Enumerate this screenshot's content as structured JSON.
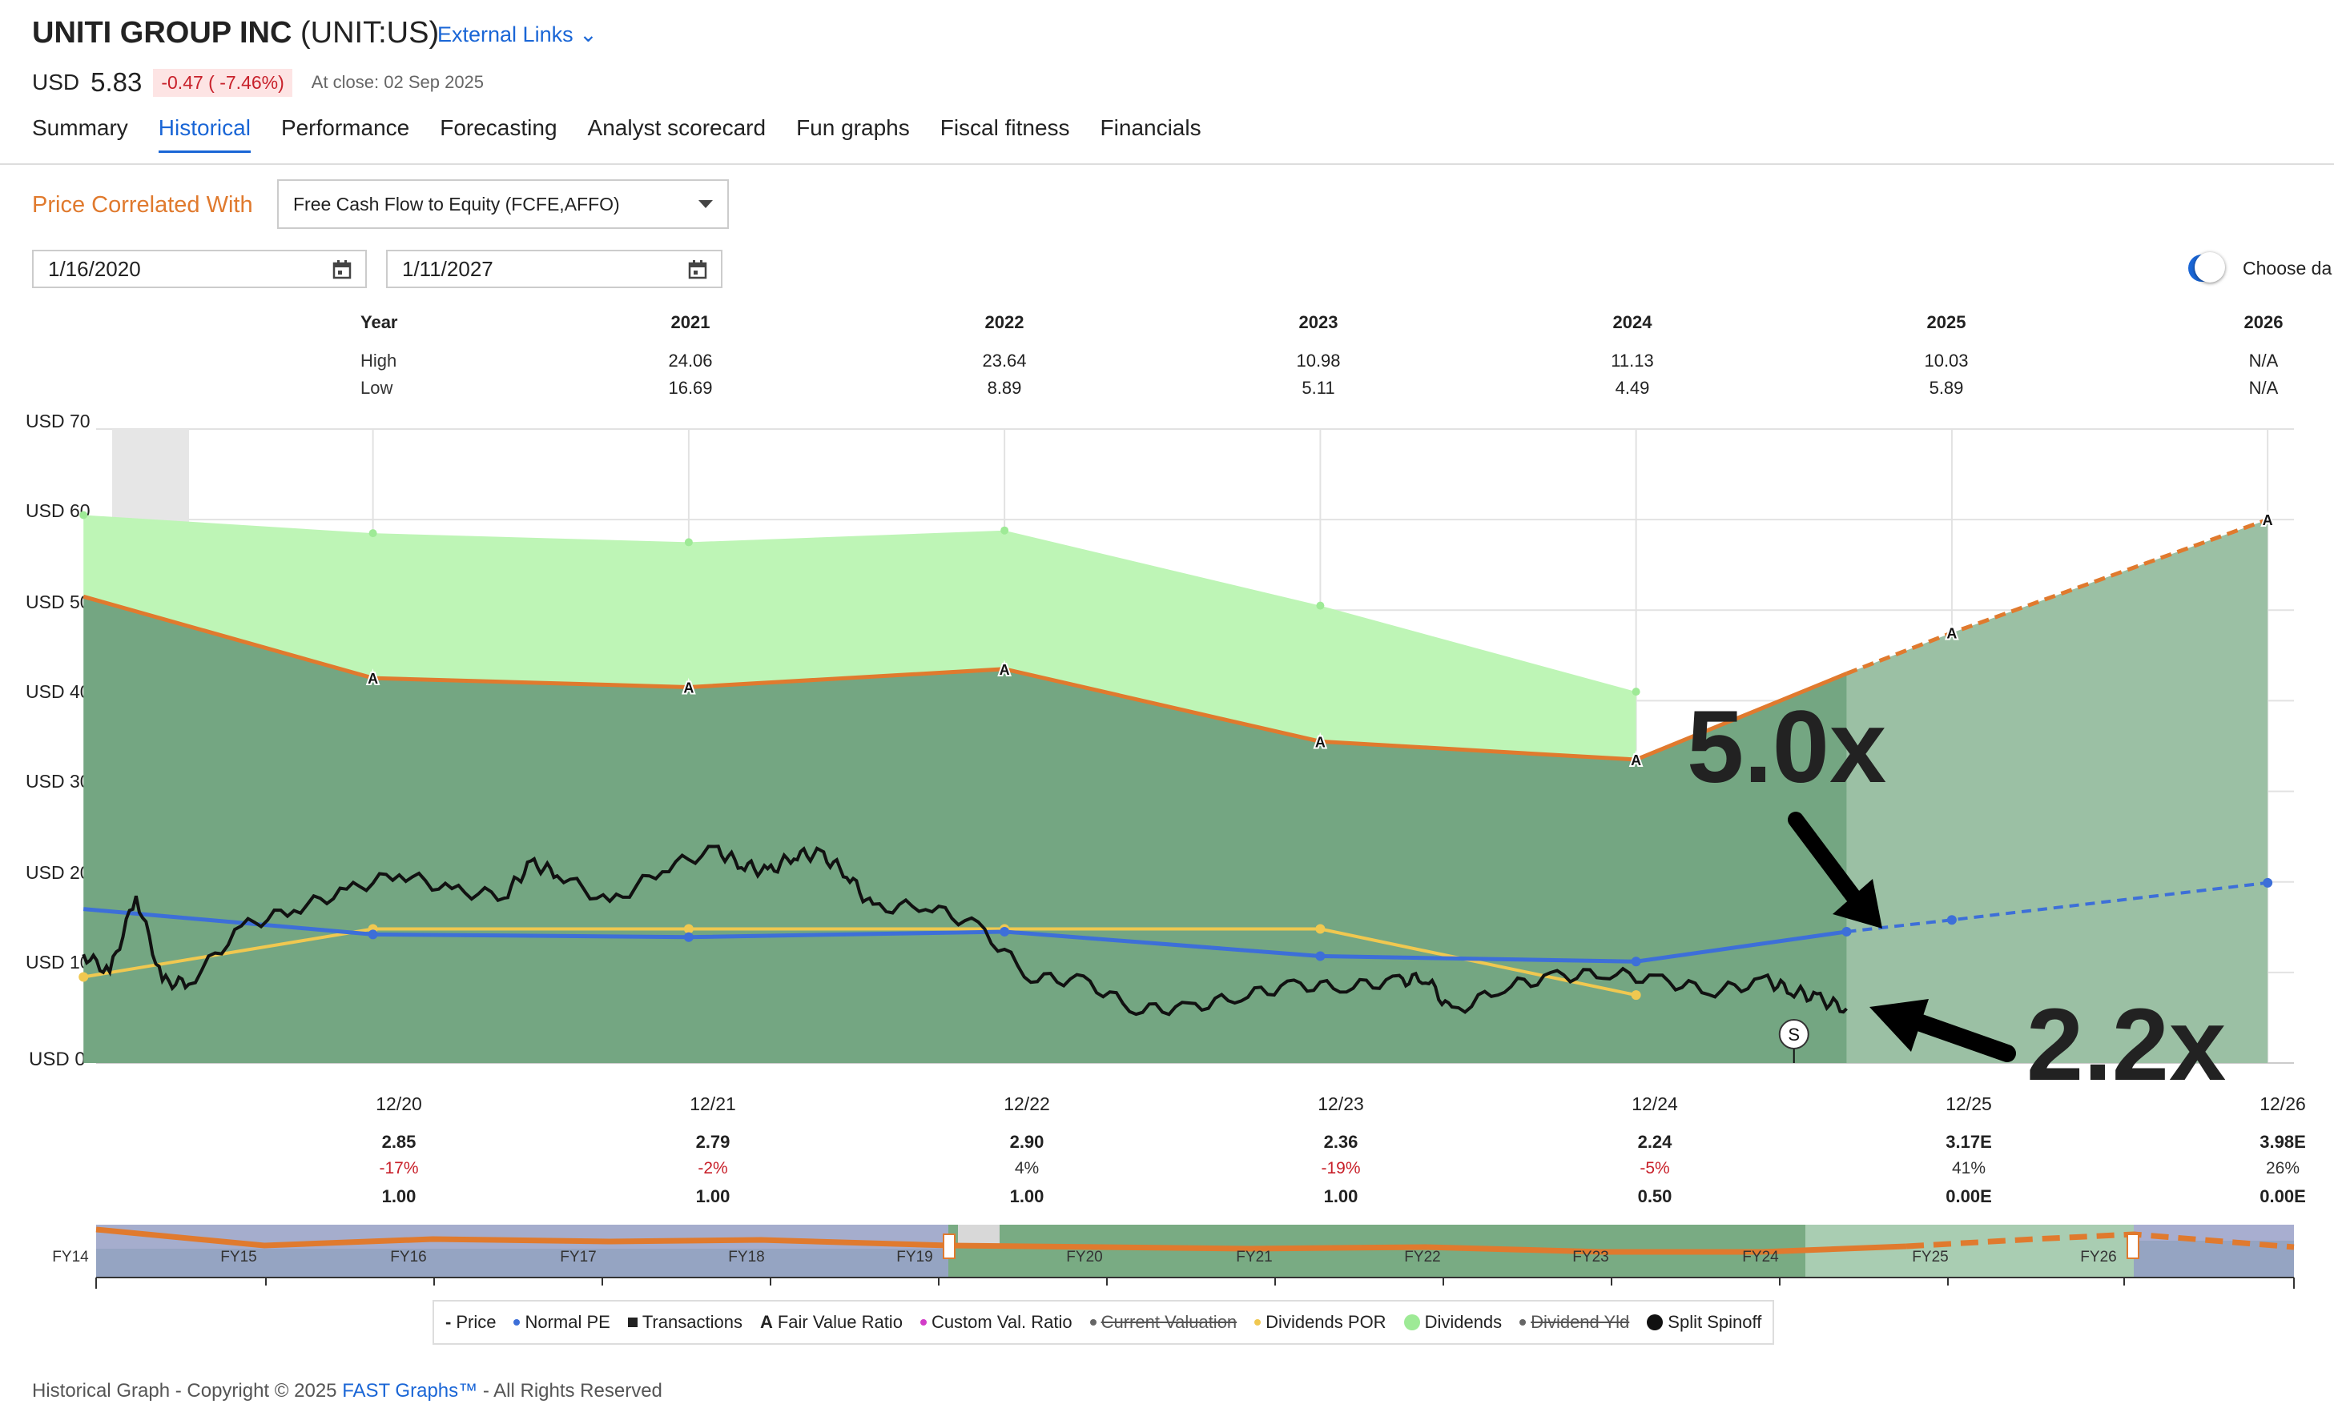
{
  "header": {
    "company": "UNITI GROUP INC",
    "ticker": "(UNIT:US)",
    "external_links": "External Links",
    "currency": "USD",
    "price": "5.83",
    "change": "-0.47 ( -7.46%)",
    "close_info": "At close: 02 Sep 2025"
  },
  "tabs": [
    "Summary",
    "Historical",
    "Performance",
    "Forecasting",
    "Analyst scorecard",
    "Fun graphs",
    "Fiscal fitness",
    "Financials"
  ],
  "active_tab": "Historical",
  "controls": {
    "price_correlated_label": "Price Correlated With",
    "metric_selected": "Free Cash Flow to Equity (FCFE,AFFO)",
    "start_date": "1/16/2020",
    "end_date": "1/11/2027",
    "choose_label": "Choose da"
  },
  "year_table": {
    "label_year": "Year",
    "label_high": "High",
    "label_low": "Low",
    "years": [
      "2021",
      "2022",
      "2023",
      "2024",
      "2025",
      "2026"
    ],
    "high": [
      "24.06",
      "23.64",
      "10.98",
      "11.13",
      "10.03",
      "N/A"
    ],
    "low": [
      "16.69",
      "8.89",
      "5.11",
      "4.49",
      "5.89",
      "N/A"
    ]
  },
  "eps_table": {
    "dates": [
      "12/20",
      "12/21",
      "12/22",
      "12/23",
      "12/24",
      "12/25",
      "12/26"
    ],
    "values": [
      "2.85",
      "2.79",
      "2.90",
      "2.36",
      "2.24",
      "3.17E",
      "3.98E"
    ],
    "growth": [
      "-17%",
      "-2%",
      "4%",
      "-19%",
      "-5%",
      "41%",
      "26%"
    ],
    "dividends": [
      "1.00",
      "1.00",
      "1.00",
      "1.00",
      "0.50",
      "0.00E",
      "0.00E"
    ]
  },
  "navigator": {
    "fy_labels": [
      "FY14",
      "FY15",
      "FY16",
      "FY17",
      "FY18",
      "FY19",
      "FY20",
      "FY21",
      "FY22",
      "FY23",
      "FY24",
      "FY25",
      "FY26"
    ]
  },
  "legend": [
    "Price",
    "Normal PE",
    "Transactions",
    "Fair Value Ratio",
    "Custom Val. Ratio",
    "Current Valuation",
    "Dividends POR",
    "Dividends",
    "Dividend Yld",
    "Split Spinoff"
  ],
  "footer": {
    "copyright": "Historical Graph - Copyright © 2025",
    "link": "FAST Graphs™",
    "rights": "- All Rights Reserved"
  },
  "annotations": {
    "multiple_high": "5.0x",
    "multiple_low": "2.2x",
    "spinoff_marker": "S"
  },
  "colors": {
    "accent": "#1a66d6",
    "orange": "#e07a2e",
    "dark_green": "#74a682",
    "light_green": "#bef5b6",
    "forecast_green": "#9bc0a4",
    "normal_pe": "#3d6fd8",
    "dividend_por": "#f0c850",
    "negative": "#c8202a"
  },
  "chart_data": {
    "type": "area",
    "ylabel": "USD",
    "y_ticks": [
      "USD 70",
      "USD 60",
      "USD 50",
      "USD 40",
      "USD 30",
      "USD 20",
      "USD 10",
      "USD 0"
    ],
    "ylim": [
      0,
      70
    ],
    "grid": true,
    "x_dates": [
      "12/20",
      "12/21",
      "12/22",
      "12/23",
      "12/24",
      "12/25",
      "12/26"
    ],
    "fair_value_line": {
      "x": [
        "2020-01",
        "2020-12",
        "2021-12",
        "2022-12",
        "2023-12",
        "2024-12",
        "2025-08",
        "2025-12",
        "2026-12"
      ],
      "y": [
        51.5,
        42.5,
        41.5,
        43.5,
        35.5,
        33.5,
        43,
        47.5,
        60
      ]
    },
    "dividends_area_top": {
      "x": [
        "2020-01",
        "2020-12",
        "2021-12",
        "2022-12",
        "2023-12",
        "2024-12"
      ],
      "y": [
        60.5,
        58.5,
        57.5,
        58.8,
        50.5,
        41
      ]
    },
    "normal_pe": {
      "x": [
        "2020-01",
        "2020-12",
        "2021-12",
        "2022-12",
        "2023-12",
        "2024-12",
        "2025-08",
        "2025-12",
        "2026-12"
      ],
      "y": [
        17,
        14.2,
        13.9,
        14.5,
        11.8,
        11.2,
        14.5,
        15.8,
        19.9
      ]
    },
    "dividends_por": {
      "x": [
        "2020-01",
        "2020-12",
        "2021-12",
        "2022-12",
        "2023-12",
        "2024-12"
      ],
      "y": [
        9.5,
        14.8,
        14.8,
        14.8,
        14.8,
        7.5
      ]
    },
    "price": {
      "x": [
        "2020-01",
        "2020-02",
        "2020-03",
        "2020-04",
        "2020-05",
        "2020-07",
        "2020-09",
        "2020-11",
        "2021-01",
        "2021-03",
        "2021-05",
        "2021-06",
        "2021-07",
        "2021-09",
        "2021-11",
        "2022-01",
        "2022-02",
        "2022-03",
        "2022-04",
        "2022-05",
        "2022-06",
        "2022-07",
        "2022-09",
        "2022-11",
        "2023-01",
        "2023-03",
        "2023-05",
        "2023-07",
        "2023-09",
        "2023-11",
        "2024-01",
        "2024-03",
        "2024-04",
        "2024-05",
        "2024-07",
        "2024-09",
        "2024-11",
        "2025-01",
        "2025-03",
        "2025-05",
        "2025-06",
        "2025-07",
        "2025-08"
      ],
      "y": [
        12,
        10,
        18.5,
        9,
        8.8,
        15,
        17,
        19,
        21,
        19,
        18.5,
        22,
        21,
        17.5,
        21.5,
        23.5,
        22,
        21,
        23,
        23,
        21,
        17,
        17.5,
        15,
        9.5,
        9,
        6,
        6,
        7.5,
        8.5,
        8.5,
        9,
        9.5,
        5.5,
        8.5,
        9.5,
        10,
        9,
        8,
        9,
        8,
        7,
        6
      ]
    }
  }
}
